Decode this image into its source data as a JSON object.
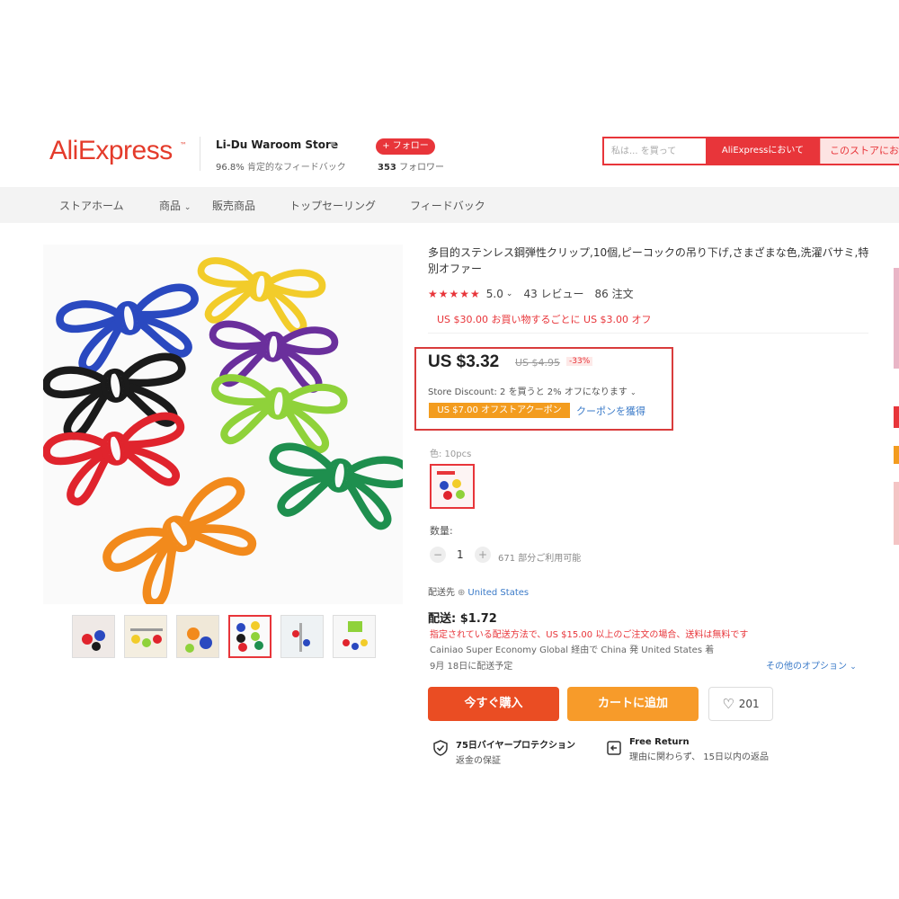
{
  "header": {
    "logo": "AliExpress",
    "store_name": "Li-Du Waroom Store",
    "store_rating_value": "96.8%",
    "store_rating_text": "肯定的なフィードバック",
    "follow_label": "+ フォロー",
    "followers_count": "353",
    "followers_label": "フォロワー",
    "search_placeholder": "私は... を買って",
    "search_button_ali": "AliExpressにおいて",
    "search_button_store": "このストアにお"
  },
  "nav": {
    "items": [
      "ストアホーム",
      "商品",
      "販売商品",
      "トップセーリング",
      "フィードバック"
    ]
  },
  "product": {
    "title": "多目的ステンレス鋼弾性クリップ,10個,ピーコックの吊り下げ,さまざまな色,洗濯バサミ,特別オファー",
    "stars": "★★★★★",
    "rating": "5.0",
    "reviews": "43 レビュー",
    "orders": "86 注文",
    "promo": "US $30.00 お買い物するごとに US $3.00 オフ",
    "price": "US $3.32",
    "old_price": "US $4.95",
    "discount": "-33%",
    "store_discount": "Store Discount: 2 を買うと 2% オフになります",
    "coupon_badge": "US $7.00 オフストアクーポン",
    "coupon_link": "クーポンを獲得",
    "color_label": "色: 10pcs",
    "qty_label": "数量:",
    "qty_value": "1",
    "qty_available": "671 部分ご利用可能",
    "ship_to_label": "配送先",
    "ship_to_country": "United States",
    "shipping_price": "配送: $1.72",
    "shipping_note": "指定されている配送方法で、US $15.00 以上のご注文の場合、送料は無料です",
    "shipping_method": "Cainiao Super Economy Global 経由で China 発 United States 着",
    "delivery_date": "9月 18日に配送予定",
    "more_options": "その他のオプション",
    "buy_now": "今すぐ購入",
    "add_to_cart": "カートに追加",
    "wishlist_count": "201",
    "protection_title": "75日バイヤープロテクション",
    "protection_sub": "返金の保証",
    "return_title": "Free Return",
    "return_sub": "理由に関わらず、 15日以内の返品"
  },
  "colors": {
    "brand_red": "#e8353a",
    "buy_now": "#ea4d23",
    "add_to_cart": "#f79b2a",
    "link_blue": "#3a7ac8",
    "clips": [
      "#2a49c0",
      "#f2cc2a",
      "#6a2f9c",
      "#1b1b1b",
      "#8fd23a",
      "#e0242d",
      "#1e8f4e",
      "#f28a1c"
    ]
  },
  "icons": [
    "chevron-down-icon",
    "star-icon",
    "globe-icon",
    "heart-icon",
    "shield-check-icon",
    "return-icon"
  ]
}
